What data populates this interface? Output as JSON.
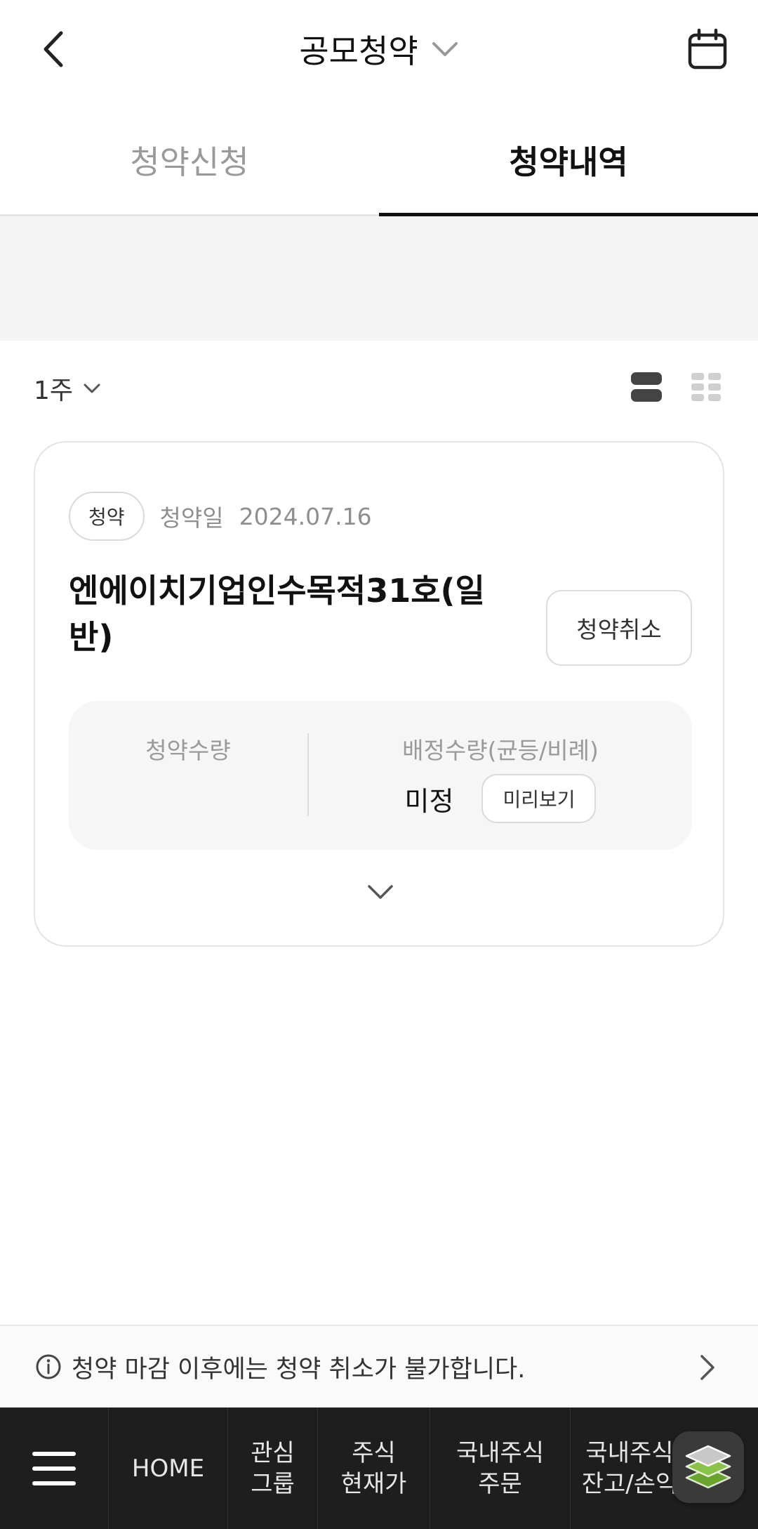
{
  "header": {
    "title": "공모청약"
  },
  "tabs": [
    {
      "label": "청약신청",
      "active": false
    },
    {
      "label": "청약내역",
      "active": true
    }
  ],
  "filter": {
    "period": "1주"
  },
  "card": {
    "badge": "청약",
    "date_label": "청약일",
    "date": "2024.07.16",
    "product_name": "엔에이치기업인수목적31호(일반)",
    "cancel_label": "청약취소",
    "qty_label": "청약수량",
    "alloc_label": "배정수량(균등/비례)",
    "alloc_value": "미정",
    "preview_label": "미리보기"
  },
  "notice": {
    "text": "청약 마감 이후에는 청약 취소가 불가합니다."
  },
  "bottom_nav": {
    "items": [
      {
        "label": "HOME"
      },
      {
        "label": "관심\n그룹"
      },
      {
        "label": "주식\n현재가"
      },
      {
        "label": "국내주식\n주문"
      },
      {
        "label": "국내주식\n잔고/손익"
      }
    ]
  },
  "colors": {
    "accent": "#111111",
    "nav_bg": "#1e1e1e",
    "fab_icon": "#8bc34a"
  }
}
